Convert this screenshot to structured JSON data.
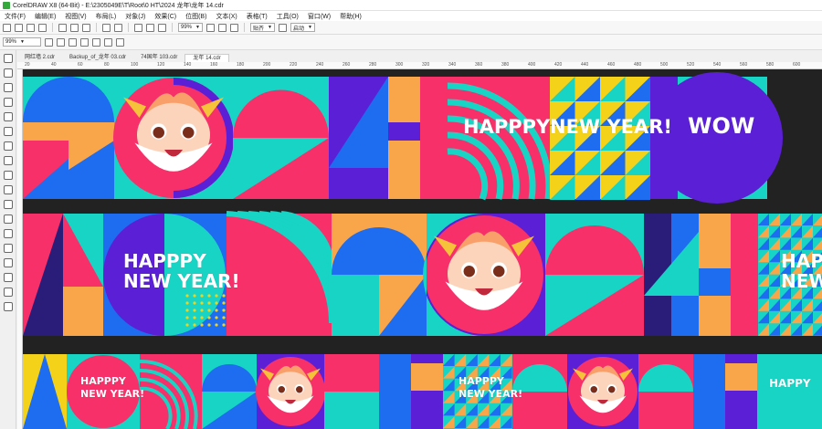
{
  "window": {
    "title": "CorelDRAW X8 (64-Bit) - E:\\2305049E\\T\\Root\\0 HT\\2024 龙年\\龙年 14.cdr"
  },
  "menu": [
    "文件(F)",
    "编辑(E)",
    "视图(V)",
    "布局(L)",
    "对象(J)",
    "效果(C)",
    "位图(B)",
    "文本(X)",
    "表格(T)",
    "工具(O)",
    "窗口(W)",
    "帮助(H)"
  ],
  "toolbar": {
    "zoom_value": "99%",
    "snap_label": "贴齐",
    "launch_label": "启动"
  },
  "propertybar": {
    "zoom_value": "99%"
  },
  "tabs": [
    {
      "label": "网红墙 2.cdr",
      "active": false
    },
    {
      "label": "Backup_of_龙年 03.cdr",
      "active": false
    },
    {
      "label": "74国年 103.cdr",
      "active": false
    },
    {
      "label": "龙年 14.cdr",
      "active": true
    }
  ],
  "ruler": {
    "ticks": [
      "20",
      "40",
      "60",
      "80",
      "100",
      "120",
      "140",
      "160",
      "180",
      "200",
      "220",
      "240",
      "260",
      "280",
      "300",
      "320",
      "340",
      "360",
      "380",
      "400",
      "420",
      "440",
      "460",
      "480",
      "500",
      "520",
      "540",
      "560",
      "580",
      "600"
    ]
  },
  "artwork": {
    "texts": {
      "happpy": "HAPPPY",
      "new_year": "NEW YEAR!",
      "wow": "WOW",
      "happy_new_year_line1": "HAPPPY",
      "happy_new_year_line2": "NEW YEAR!",
      "happy": "HAPPPY",
      "happy_short": "HAPPY",
      "new": "NEW"
    },
    "colors": {
      "cyan": "#17d4c4",
      "magenta": "#f7306a",
      "purple": "#5b1fd6",
      "orange": "#f9a64a",
      "blue": "#1e6cf0",
      "navy": "#2a1d7a",
      "yellow": "#f4d21a",
      "background": "#222222"
    }
  }
}
